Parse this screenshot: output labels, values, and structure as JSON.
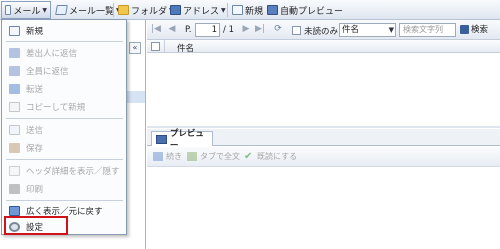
{
  "toolbar": {
    "mail": "メール",
    "mail_list": "メール一覧",
    "folder": "フォルダ",
    "address": "アドレス",
    "new": "新規",
    "auto_preview": "自動プレビュー"
  },
  "menu": {
    "items": [
      {
        "label": "新規",
        "enabled": true
      },
      {
        "label": "差出人に返信",
        "enabled": false
      },
      {
        "label": "全員に返信",
        "enabled": false
      },
      {
        "label": "転送",
        "enabled": false
      },
      {
        "label": "コピーして新規",
        "enabled": false
      },
      {
        "label": "送信",
        "enabled": false
      },
      {
        "label": "保存",
        "enabled": false
      },
      {
        "label": "ヘッダ詳細を表示／隠す",
        "enabled": false
      },
      {
        "label": "印刷",
        "enabled": false
      },
      {
        "label": "広く表示／元に戻す",
        "enabled": true
      },
      {
        "label": "設定",
        "enabled": true
      }
    ],
    "highlight_color": "#d0121b"
  },
  "collapse_symbol": "«",
  "nav": {
    "first": "|◀",
    "prev": "◀",
    "page_prefix": "P.",
    "page_value": "1",
    "page_total": "/ 1",
    "next": "▶",
    "last": "▶|",
    "refresh": "⟳",
    "unread_only": "未読のみ",
    "field_select": "件名",
    "search_placeholder": "検索文字列",
    "search_button": "検索"
  },
  "list": {
    "header_title": "件名"
  },
  "preview": {
    "tab": "プレビュー",
    "tools": [
      "続き",
      "タブで全文",
      "既読にする"
    ]
  }
}
